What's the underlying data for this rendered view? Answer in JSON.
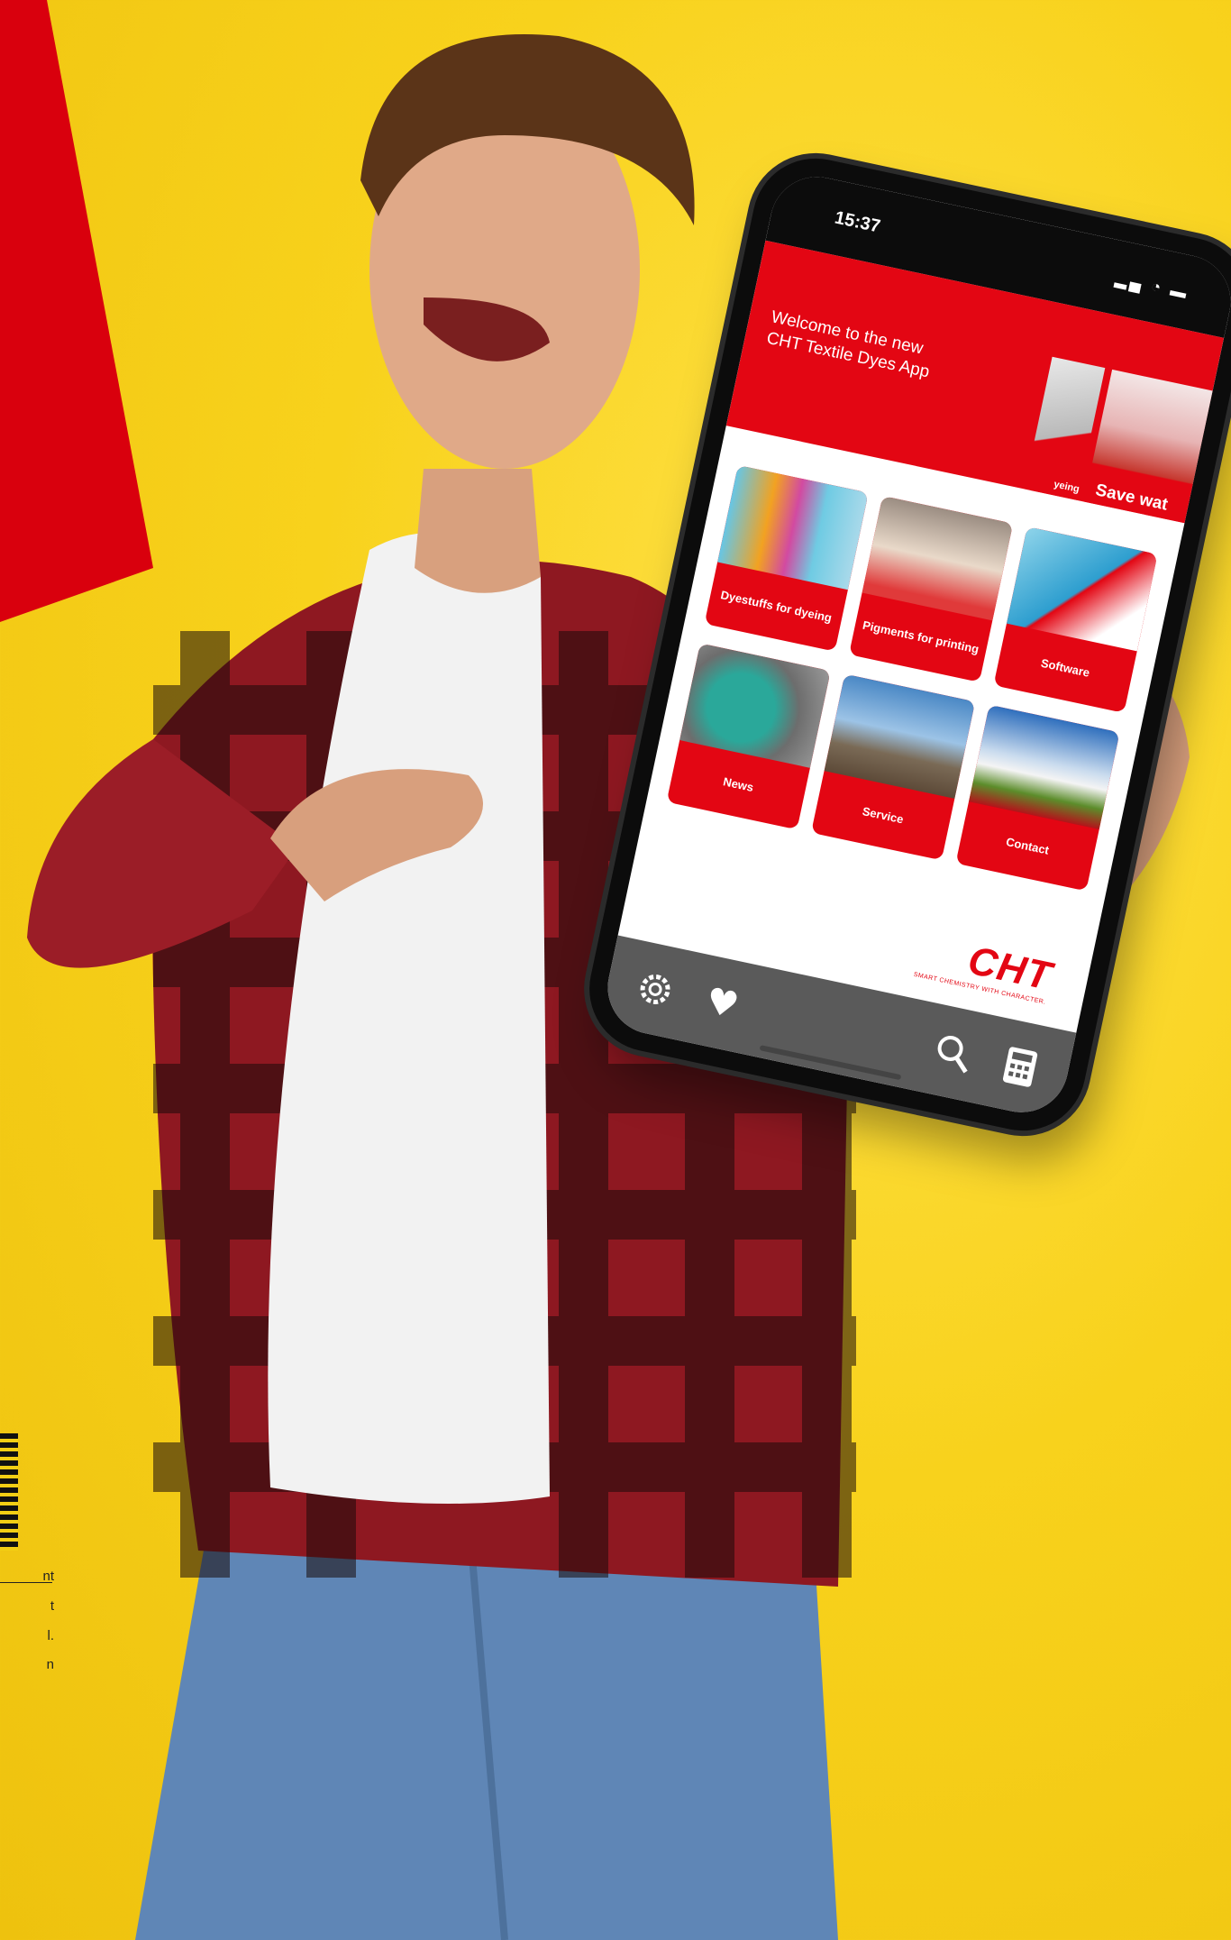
{
  "page": {
    "side_text": [
      "nt",
      "t",
      "l.",
      "n"
    ]
  },
  "phone": {
    "status_time": "15:37",
    "banner": {
      "welcome_line1": "Welcome to the new",
      "welcome_line2": "CHT Textile Dyes App",
      "slide1_caption": "yeing",
      "slide2_caption": "Save wat"
    },
    "tiles": [
      {
        "label": "Dyestuffs for dyeing"
      },
      {
        "label": "Pigments for printing"
      },
      {
        "label": "Software"
      },
      {
        "label": "News"
      },
      {
        "label": "Service"
      },
      {
        "label": "Contact"
      }
    ],
    "logo": {
      "mark": "CHT",
      "tagline": "SMART CHEMISTRY WITH CHARACTER."
    },
    "tabbar": {
      "icons": [
        "gear-icon",
        "heart-icon",
        "search-icon",
        "calculator-icon"
      ]
    },
    "colors": {
      "accent": "#e30613",
      "tabbar": "#5a5a5a",
      "background": "#f8d21c"
    }
  }
}
